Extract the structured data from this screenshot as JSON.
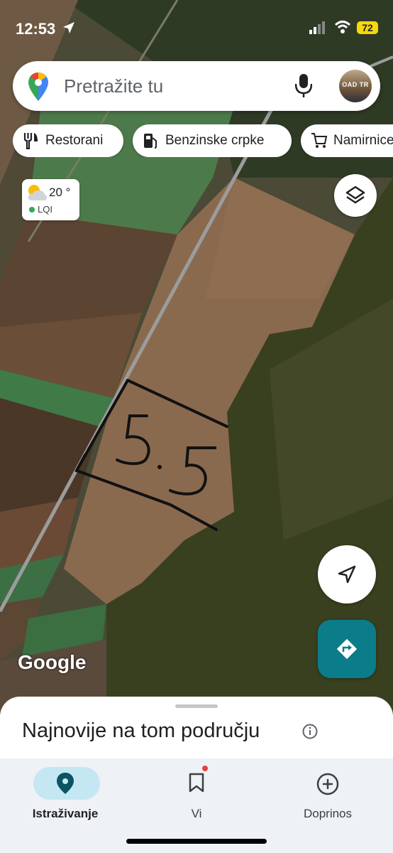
{
  "status_bar": {
    "time": "12:53",
    "battery": "72",
    "icons": [
      "location-arrow-icon",
      "signal-icon",
      "wifi-icon",
      "battery-icon"
    ]
  },
  "search": {
    "placeholder": "Pretražite tu"
  },
  "chips": [
    {
      "label": "Restorani",
      "icon": "restaurant-icon"
    },
    {
      "label": "Benzinske crpke",
      "icon": "gas-station-icon"
    },
    {
      "label": "Namirnice",
      "icon": "shopping-cart-icon"
    }
  ],
  "weather": {
    "temp": "20 °",
    "aqi": "LQI",
    "icon": "partly-cloudy-icon"
  },
  "map": {
    "overlay_text": "5.5",
    "attribution": "Google"
  },
  "sheet": {
    "title": "Najnovije na tom području"
  },
  "nav": [
    {
      "label": "Istraživanje",
      "icon": "pin-icon",
      "active": true
    },
    {
      "label": "Vi",
      "icon": "bookmark-icon",
      "badge": true
    },
    {
      "label": "Doprinos",
      "icon": "add-circle-icon"
    }
  ],
  "colors": {
    "accent": "#0b7c8a",
    "active_pill": "#c4e7f3",
    "battery": "#f5d90a"
  }
}
